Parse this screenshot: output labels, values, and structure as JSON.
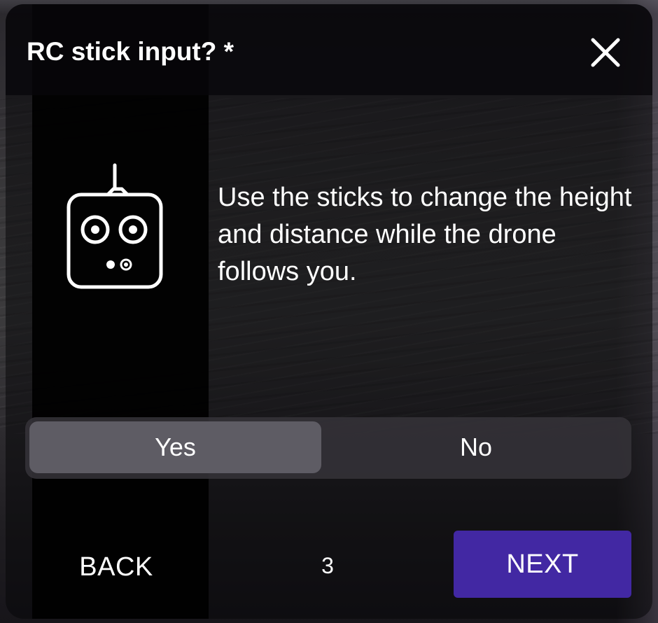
{
  "dialog": {
    "title": "RC stick input? *",
    "close_icon": "close-icon",
    "illustration_icon": "remote-controller-icon",
    "description": "Use the sticks to change the height and distance while the drone follows you."
  },
  "choice": {
    "options": [
      "Yes",
      "No"
    ],
    "selected": "Yes"
  },
  "footer": {
    "back_label": "BACK",
    "page_number": "3",
    "next_label": "NEXT"
  },
  "colors": {
    "accent": "#4228a3",
    "selected_option": "#5e5c64",
    "text": "#ffffff"
  }
}
